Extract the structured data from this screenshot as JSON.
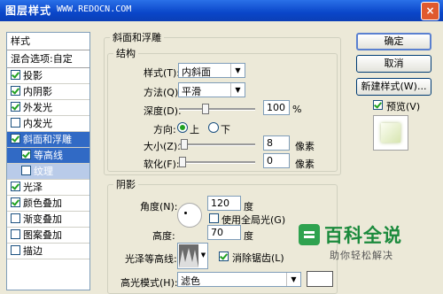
{
  "window": {
    "title": "图层样式",
    "url": "WWW.REDOCN.COM",
    "close": "×"
  },
  "left_panel": {
    "header": "样式",
    "blend": "混合选项:自定",
    "items": [
      {
        "label": "投影",
        "checked": true
      },
      {
        "label": "内阴影",
        "checked": true
      },
      {
        "label": "外发光",
        "checked": true
      },
      {
        "label": "内发光",
        "checked": false
      },
      {
        "label": "斜面和浮雕",
        "checked": true,
        "selected": true
      },
      {
        "label": "等高线",
        "checked": true,
        "sub": true
      },
      {
        "label": "纹理",
        "checked": false,
        "sub": true
      },
      {
        "label": "光泽",
        "checked": true
      },
      {
        "label": "颜色叠加",
        "checked": true
      },
      {
        "label": "渐变叠加",
        "checked": false
      },
      {
        "label": "图案叠加",
        "checked": false
      },
      {
        "label": "描边",
        "checked": false
      }
    ]
  },
  "bevel": {
    "title": "斜面和浮雕",
    "structure": "结构",
    "style_label": "样式(T):",
    "style_value": "内斜面",
    "method_label": "方法(Q):",
    "method_value": "平滑",
    "depth_label": "深度(D):",
    "depth_value": "100",
    "depth_unit": "%",
    "dir_label": "方向:",
    "dir_up": "上",
    "dir_down": "下",
    "size_label": "大小(Z):",
    "size_value": "8",
    "size_unit": "像素",
    "soften_label": "软化(F):",
    "soften_value": "0",
    "soften_unit": "像素"
  },
  "shading": {
    "title": "阴影",
    "angle_label": "角度(N):",
    "angle_value": "120",
    "angle_unit": "度",
    "global_light": "使用全局光(G)",
    "altitude_label": "高度:",
    "altitude_value": "70",
    "altitude_unit": "度",
    "gloss_label": "光泽等高线:",
    "antialias": "消除锯齿(L)",
    "highlight_label": "高光模式(H):",
    "highlight_value": "滤色"
  },
  "buttons": {
    "ok": "确定",
    "cancel": "取消",
    "new_style": "新建样式(W)...",
    "preview": "预览(V)"
  },
  "watermark": {
    "title": "百科全说",
    "subtitle": "助你轻松解决"
  }
}
